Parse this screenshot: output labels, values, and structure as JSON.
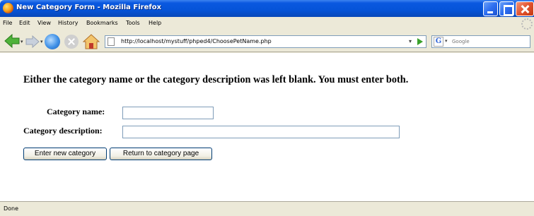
{
  "window": {
    "title": "New Category Form - Mozilla Firefox"
  },
  "menu": [
    "File",
    "Edit",
    "View",
    "History",
    "Bookmarks",
    "Tools",
    "Help"
  ],
  "navigation": {
    "url": "http://localhost/mystuff/phped4/ChoosePetName.php",
    "search_placeholder": "Google",
    "search_engine_icon": "G"
  },
  "form": {
    "error_message": "Either the category name or the category description was left blank. You must enter both.",
    "category_name_label": "Category name:",
    "category_name_value": "",
    "category_description_label": "Category description:",
    "category_description_value": "",
    "enter_button": "Enter new category",
    "return_button": "Return to category page"
  },
  "status": {
    "text": "Done"
  }
}
